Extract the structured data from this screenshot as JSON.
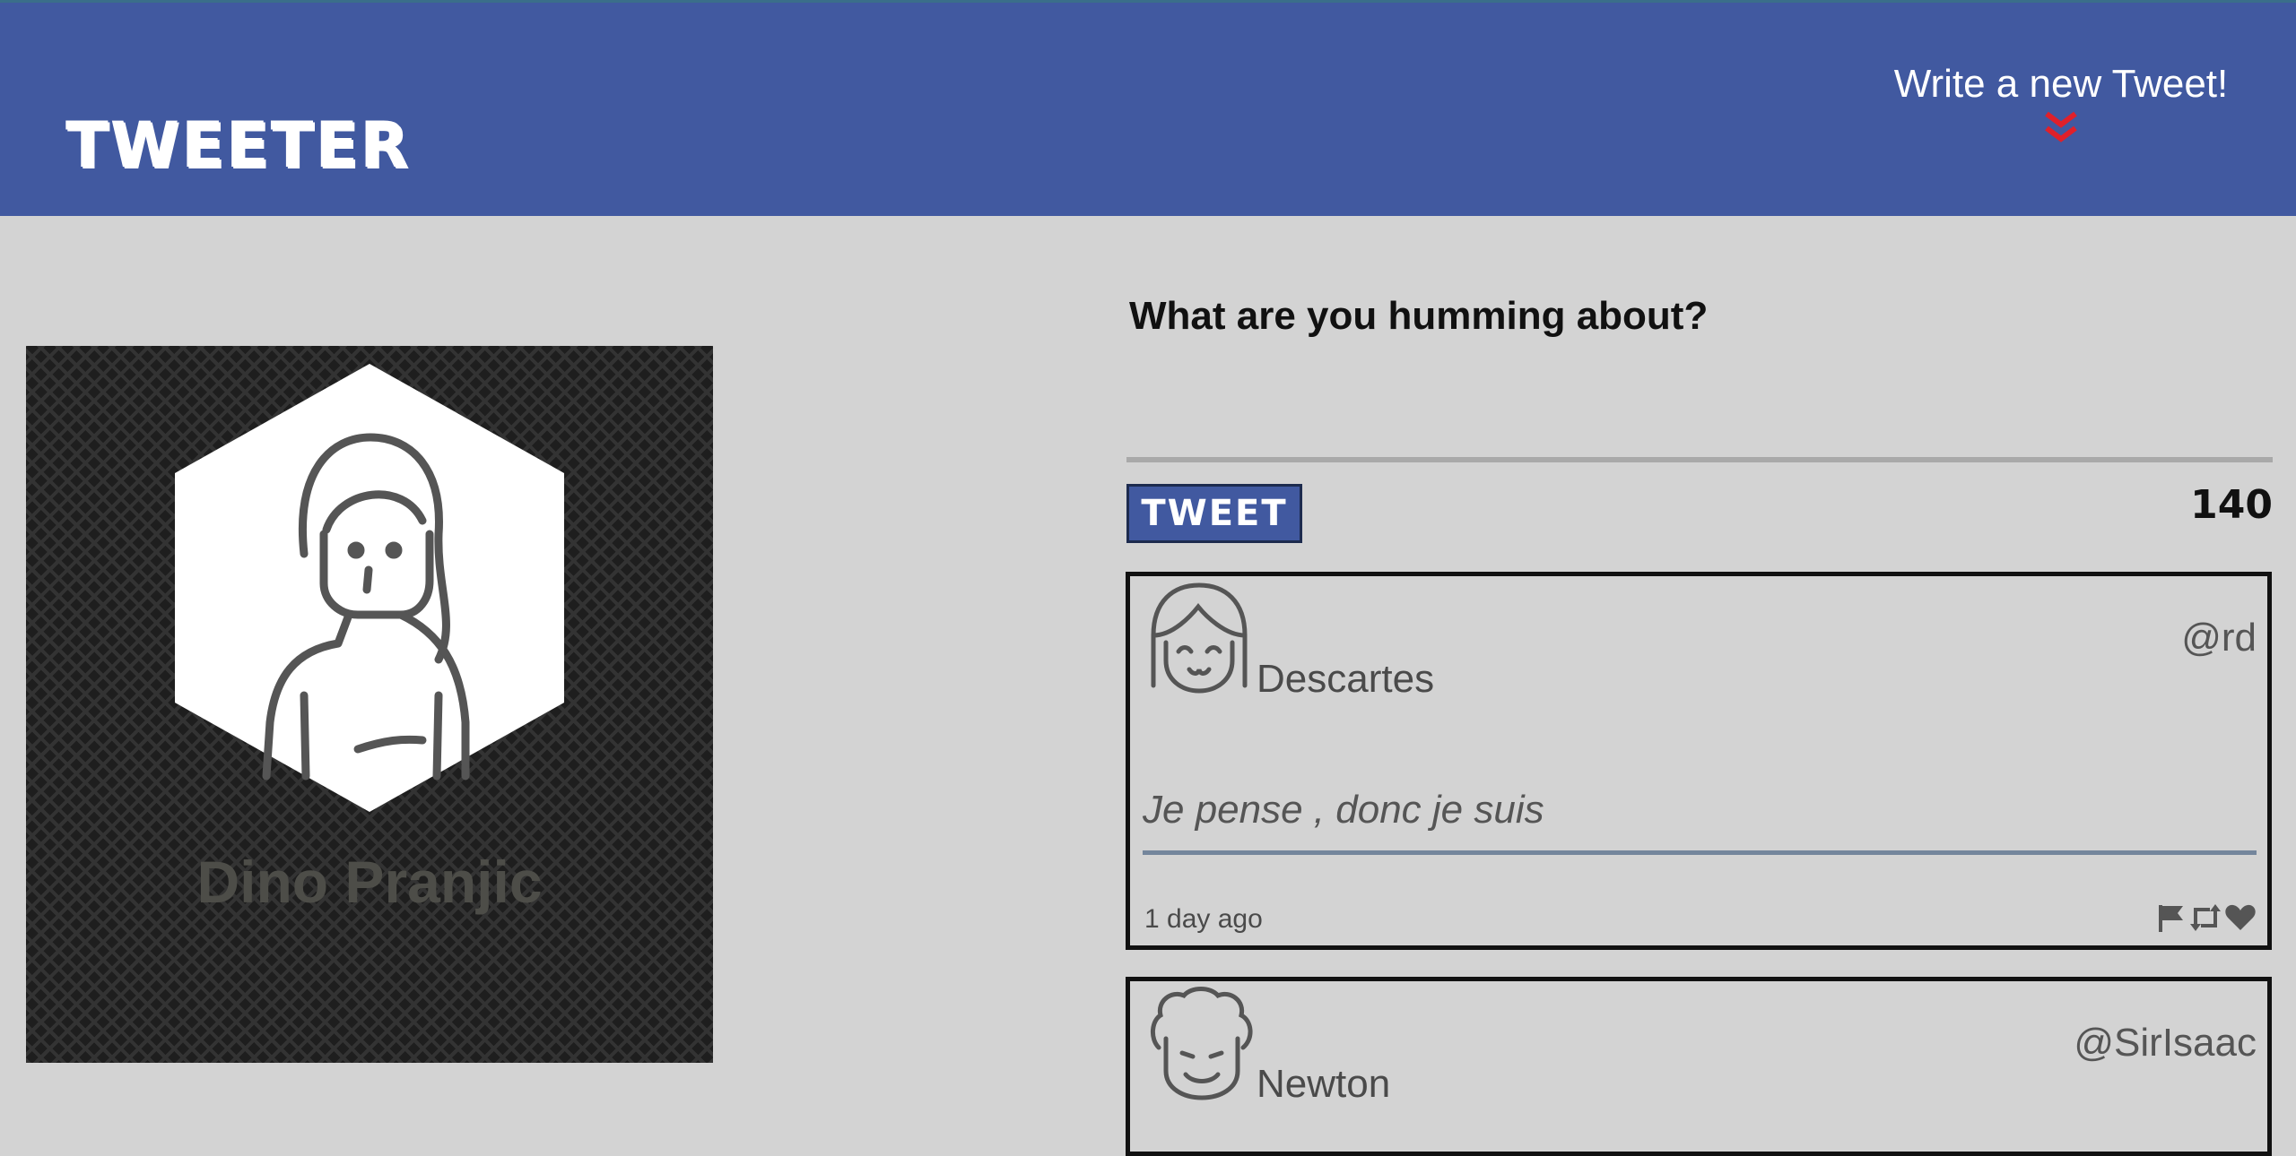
{
  "nav": {
    "brand": "TWEETER",
    "compose_toggle_label": "Write a new Tweet!"
  },
  "profile": {
    "name": "Dino Pranjic"
  },
  "composer": {
    "prompt": "What are you humming about?",
    "textarea_value": "",
    "button_label": "TWEET",
    "char_count": "140"
  },
  "tweets": [
    {
      "name": "Descartes",
      "handle": "@rd",
      "content": "Je pense , donc je suis",
      "time": "1 day ago",
      "actions": [
        "flag-icon",
        "retweet-icon",
        "heart-icon"
      ]
    },
    {
      "name": "Newton",
      "handle": "@SirIsaac"
    }
  ],
  "colors": {
    "nav_bg": "#4159a0",
    "page_bg": "#d3d3d3",
    "chevron": "#e0202a"
  }
}
